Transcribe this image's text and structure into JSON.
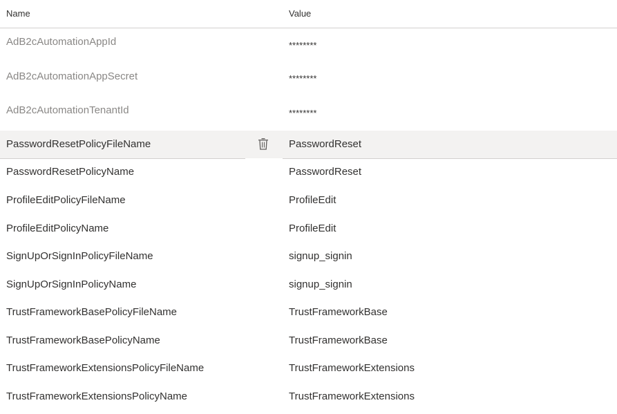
{
  "table": {
    "headers": {
      "name": "Name",
      "value": "Value"
    },
    "rows": [
      {
        "name": "AdB2cAutomationAppId",
        "value": "********",
        "secret": true
      },
      {
        "name": "AdB2cAutomationAppSecret",
        "value": "********",
        "secret": true
      },
      {
        "name": "AdB2cAutomationTenantId",
        "value": "********",
        "secret": true
      },
      {
        "name": "PasswordResetPolicyFileName",
        "value": "PasswordReset",
        "selected": true
      },
      {
        "name": "PasswordResetPolicyName",
        "value": "PasswordReset"
      },
      {
        "name": "ProfileEditPolicyFileName",
        "value": "ProfileEdit"
      },
      {
        "name": "ProfileEditPolicyName",
        "value": "ProfileEdit"
      },
      {
        "name": "SignUpOrSignInPolicyFileName",
        "value": "signup_signin"
      },
      {
        "name": "SignUpOrSignInPolicyName",
        "value": "signup_signin"
      },
      {
        "name": "TrustFrameworkBasePolicyFileName",
        "value": "TrustFrameworkBase"
      },
      {
        "name": "TrustFrameworkBasePolicyName",
        "value": "TrustFrameworkBase"
      },
      {
        "name": "TrustFrameworkExtensionsPolicyFileName",
        "value": "TrustFrameworkExtensions"
      },
      {
        "name": "TrustFrameworkExtensionsPolicyName",
        "value": "TrustFrameworkExtensions"
      }
    ]
  },
  "icons": {
    "delete": "trash-icon"
  }
}
